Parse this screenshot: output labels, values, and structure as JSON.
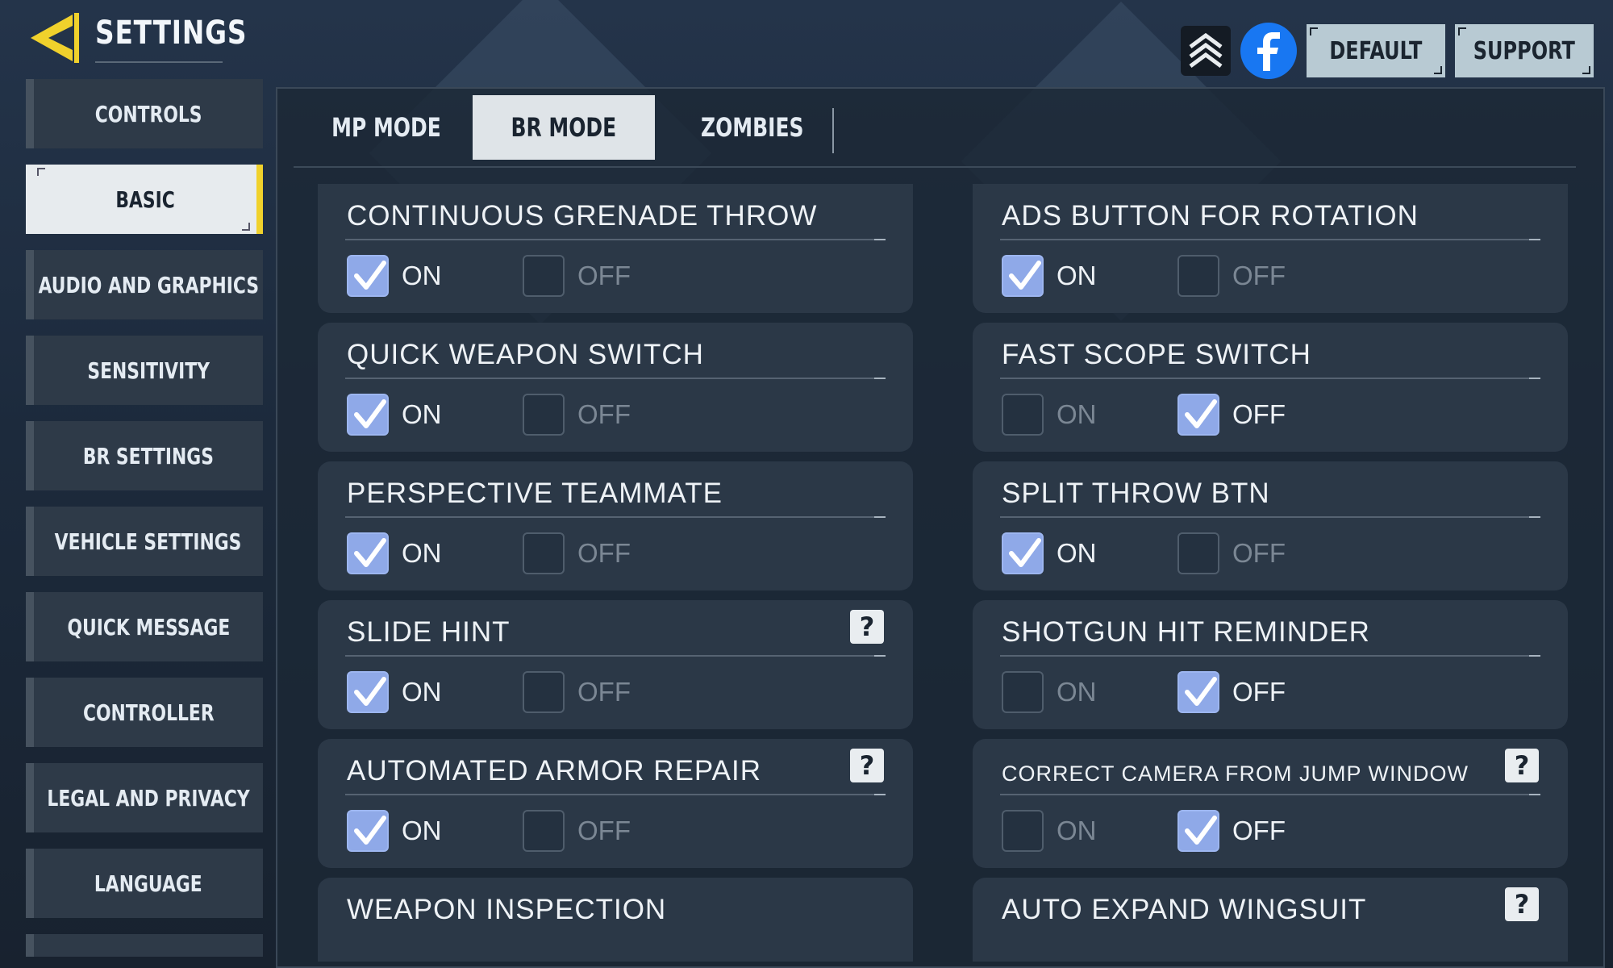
{
  "header": {
    "title": "SETTINGS",
    "default_label": "DEFAULT",
    "support_label": "SUPPORT"
  },
  "sidebar": {
    "items": [
      {
        "label": "CONTROLS"
      },
      {
        "label": "BASIC"
      },
      {
        "label": "AUDIO AND GRAPHICS"
      },
      {
        "label": "SENSITIVITY"
      },
      {
        "label": "BR SETTINGS"
      },
      {
        "label": "VEHICLE SETTINGS"
      },
      {
        "label": "QUICK MESSAGE"
      },
      {
        "label": "CONTROLLER"
      },
      {
        "label": "LEGAL AND PRIVACY"
      },
      {
        "label": "LANGUAGE"
      }
    ],
    "active": "BASIC"
  },
  "tabs": [
    {
      "label": "MP MODE"
    },
    {
      "label": "BR MODE"
    },
    {
      "label": "ZOMBIES"
    }
  ],
  "active_tab": "BR MODE",
  "options": {
    "on": "ON",
    "off": "OFF"
  },
  "settings_left": [
    {
      "title": "CONTINUOUS GRENADE THROW",
      "value": "ON",
      "help": false
    },
    {
      "title": "QUICK WEAPON SWITCH",
      "value": "ON",
      "help": false
    },
    {
      "title": "PERSPECTIVE TEAMMATE",
      "value": "ON",
      "help": false
    },
    {
      "title": "SLIDE HINT",
      "value": "ON",
      "help": true
    },
    {
      "title": "AUTOMATED ARMOR REPAIR",
      "value": "ON",
      "help": true
    },
    {
      "title": "WEAPON INSPECTION",
      "value": null,
      "help": false
    }
  ],
  "settings_right": [
    {
      "title": "ADS BUTTON FOR ROTATION",
      "value": "ON",
      "help": false
    },
    {
      "title": "FAST SCOPE SWITCH",
      "value": "OFF",
      "help": false
    },
    {
      "title": "SPLIT THROW BTN",
      "value": "ON",
      "help": false
    },
    {
      "title": "SHOTGUN HIT REMINDER",
      "value": "OFF",
      "help": false
    },
    {
      "title": "CORRECT CAMERA FROM JUMP WINDOW",
      "value": "OFF",
      "help": true
    },
    {
      "title": "AUTO EXPAND WINGSUIT",
      "value": null,
      "help": true
    }
  ],
  "help_symbol": "?",
  "colors": {
    "accent_yellow": "#f0d12c",
    "checkbox_checked": "#8fa9e8",
    "facebook_blue": "#1877f2"
  }
}
